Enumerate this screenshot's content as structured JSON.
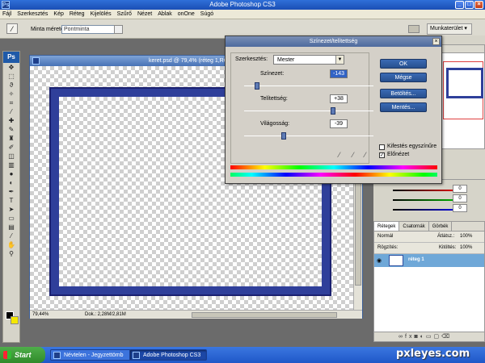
{
  "app": {
    "title": "Adobe Photoshop CS3",
    "logo": "Ps"
  },
  "menu": [
    "Fájl",
    "Szerkesztés",
    "Kép",
    "Réteg",
    "Kijelölés",
    "Szűrő",
    "Nézet",
    "Ablak",
    "onOne",
    "Súgó"
  ],
  "options_bar": {
    "sample_label": "Minta mérete:",
    "sample_value": "Pontminta",
    "workspace": "Munkaterület ▾"
  },
  "document": {
    "title": "keret.psd @ 79,4% (réteg 1,RGB",
    "zoom": "79,44%",
    "doc_size": "Dok.: 2,28M/2,81M",
    "frame_color": "#2f3f9a"
  },
  "dialog": {
    "title": "Színezet/telítettség",
    "edit_label": "Szerkesztés:",
    "edit_value": "Mester",
    "hue_label": "Színezet:",
    "hue_value": "-143",
    "sat_label": "Telítettség:",
    "sat_value": "+38",
    "light_label": "Világosság:",
    "light_value": "-39",
    "hue_level": -143,
    "sat_level": 38,
    "light_level": -39,
    "buttons": {
      "ok": "OK",
      "cancel": "Mégse",
      "load": "Betöltés...",
      "save": "Mentés..."
    },
    "colorize_label": "Kifestés egyszínűre",
    "preview_label": "Előnézet",
    "preview_checked": true
  },
  "color_panel": {
    "values": [
      "0",
      "0",
      "0"
    ]
  },
  "layers_panel": {
    "tabs": [
      "Rétegek",
      "Csatornák",
      "Görbék"
    ],
    "blend_mode": "Normál",
    "opacity_label": "Átlátsz.:",
    "opacity": "100%",
    "lock_label": "Rögzítés:",
    "fill_label": "Kitöltés:",
    "fill": "100%",
    "layer_name": "réteg 1"
  },
  "taskbar": {
    "start": "Start",
    "tasks": [
      "Névtelen - Jegyzettömb",
      "Adobe Photoshop CS3"
    ]
  },
  "watermark": "pxleyes.com"
}
